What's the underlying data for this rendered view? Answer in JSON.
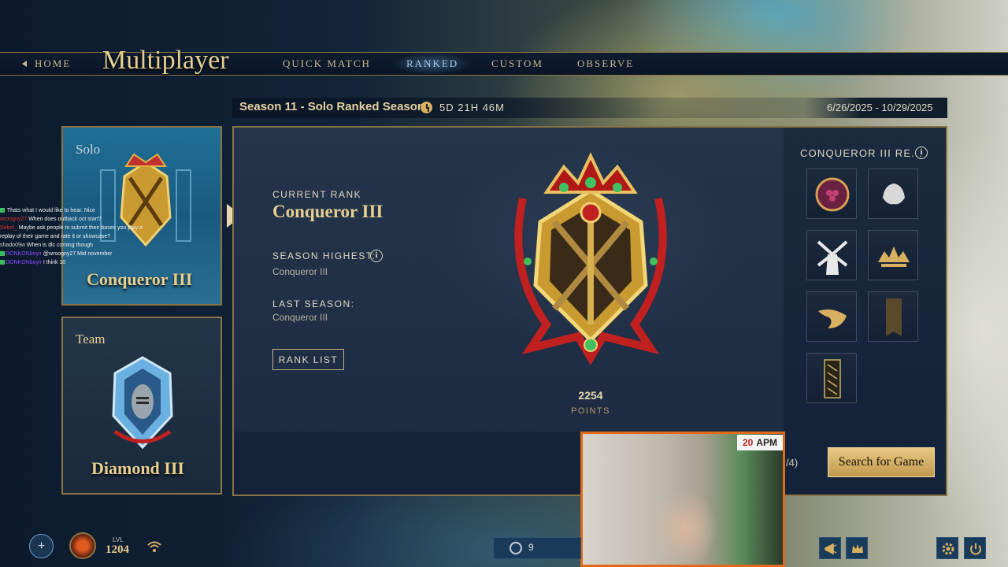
{
  "nav": {
    "home": "HOME",
    "title": "Multiplayer",
    "tabs": [
      {
        "label": "QUICK MATCH",
        "active": false
      },
      {
        "label": "RANKED",
        "active": true
      },
      {
        "label": "CUSTOM",
        "active": false
      },
      {
        "label": "OBSERVE",
        "active": false
      }
    ]
  },
  "season": {
    "title": "Season 11 - Solo Ranked Season",
    "time_remaining": "5D 21H 46M",
    "dates": "6/26/2025 - 10/29/2025"
  },
  "cards": {
    "solo": {
      "label": "Solo",
      "rank": "Conqueror III"
    },
    "team": {
      "label": "Team",
      "rank": "Diamond III"
    }
  },
  "rank_panel": {
    "current_rank_label": "CURRENT RANK",
    "current_rank": "Conqueror III",
    "season_highest_label": "SEASON HIGHEST:",
    "season_highest": "Conqueror III",
    "last_season_label": "LAST SEASON:",
    "last_season": "Conqueror III",
    "rank_list_button": "RANK LIST",
    "points": "2254",
    "points_label": "POINTS"
  },
  "rewards": {
    "title": "CONQUEROR III RE...",
    "items": [
      "grape-portrait-icon",
      "silver-crest-icon",
      "windmill-icon",
      "sun-emblem-icon",
      "wave-emblem-icon",
      "banner-icon",
      "pattern-banner-icon"
    ]
  },
  "queue": {
    "count": "/4)",
    "search_button": "Search for Game"
  },
  "chat": [
    {
      "user": "",
      "text": "Thats what I would like to hear. Nice"
    },
    {
      "user": "wroogny27",
      "text": "When does outback oct start?"
    },
    {
      "user": "Sebel_",
      "text": "Maybe ask people to submit their bases you play a replay of their game and rate it or showcase?"
    },
    {
      "user": "shado09w",
      "text": "When is dlc coming though"
    },
    {
      "user": "DONKONboyir",
      "text": "@wroogny27 Mid november"
    },
    {
      "user": "DONKONboyir",
      "text": "I think 10"
    }
  ],
  "webcam": {
    "apm_value": "20",
    "apm_label": "APM"
  },
  "bottom": {
    "level_label": "LVL",
    "level": "1204",
    "friends_count": "9"
  },
  "colors": {
    "gold": "#e7cf90",
    "accent_blue": "#1a3a5a",
    "cta": "#e8c880",
    "cam_border": "#e06a1a"
  }
}
